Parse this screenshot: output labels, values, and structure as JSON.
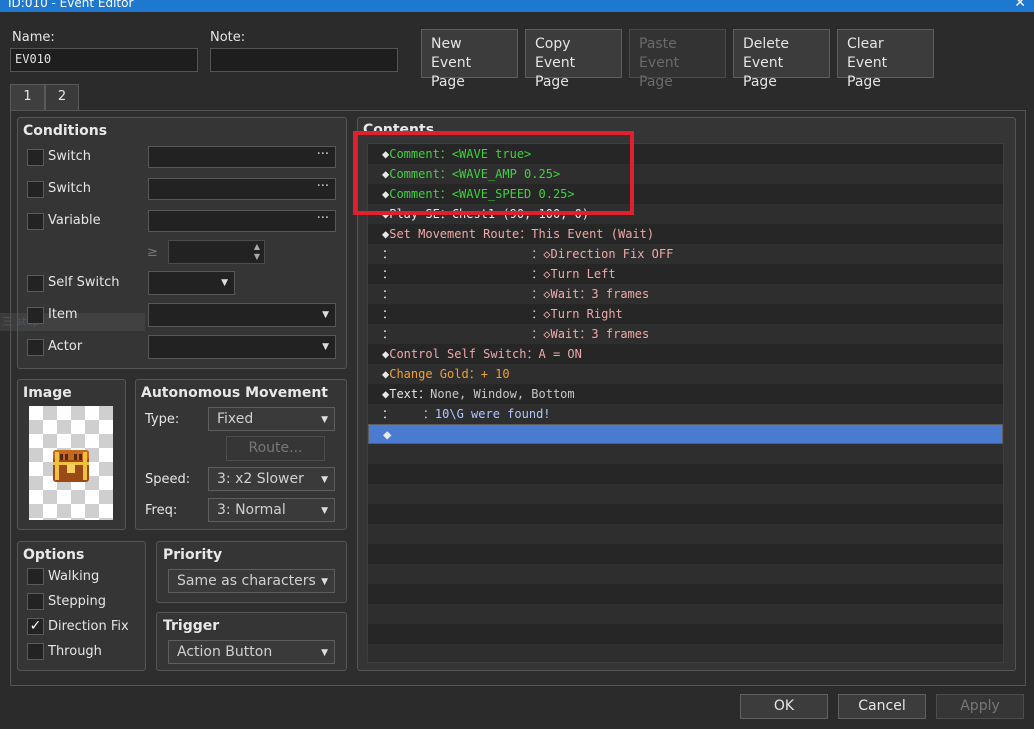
{
  "window": {
    "title": "ID:010 - Event Editor",
    "close_glyph": "✕"
  },
  "name": {
    "label": "Name:",
    "value": "EV010"
  },
  "note": {
    "label": "Note:",
    "value": ""
  },
  "toolbar": {
    "new": [
      "New",
      "Event Page"
    ],
    "copy": [
      "Copy",
      "Event Page"
    ],
    "paste": [
      "Paste",
      "Event Page"
    ],
    "delete": [
      "Delete",
      "Event Page"
    ],
    "clear": [
      "Clear",
      "Event Page"
    ]
  },
  "tabs": [
    "1",
    "2"
  ],
  "conditions": {
    "title": "Conditions",
    "switch1": "Switch",
    "switch2": "Switch",
    "variable": "Variable",
    "gte": "≥",
    "self_switch": "Self Switch",
    "item": "Item",
    "actor": "Actor",
    "dots": "···",
    "ghost_text": "三 stcp"
  },
  "image": {
    "title": "Image",
    "icon": "treasure-chest"
  },
  "autonomous": {
    "title": "Autonomous Movement",
    "type_label": "Type:",
    "type_value": "Fixed",
    "route_label": "Route...",
    "speed_label": "Speed:",
    "speed_value": "3: x2 Slower",
    "freq_label": "Freq:",
    "freq_value": "3: Normal"
  },
  "options": {
    "title": "Options",
    "items": [
      {
        "label": "Walking",
        "checked": ""
      },
      {
        "label": "Stepping",
        "checked": ""
      },
      {
        "label": "Direction Fix",
        "checked": "✓"
      },
      {
        "label": "Through",
        "checked": ""
      }
    ]
  },
  "priority": {
    "title": "Priority",
    "value": "Same as characters"
  },
  "trigger": {
    "title": "Trigger",
    "value": "Action Button"
  },
  "contents": {
    "title": "Contents",
    "rows": [
      {
        "prefix": "◆",
        "cmd": "Comment：",
        "arg": "<WAVE true>"
      },
      {
        "prefix": "◆",
        "cmd": "Comment：",
        "arg": "<WAVE_AMP 0.25>"
      },
      {
        "prefix": "◆",
        "cmd": "Comment：",
        "arg": "<WAVE_SPEED 0.25>"
      },
      {
        "prefix": "◆",
        "cmd": "Play SE：",
        "arg": "Chest1 (90, 100, 0)"
      },
      {
        "prefix": "◆",
        "cmd": "Set Movement Route：",
        "arg": "This Event (Wait)"
      },
      {
        "prefix": "：",
        "cmd": "                   ：",
        "arg": "◇Direction Fix OFF"
      },
      {
        "prefix": "：",
        "cmd": "                   ：",
        "arg": "◇Turn Left"
      },
      {
        "prefix": "：",
        "cmd": "                   ：",
        "arg": "◇Wait：3 frames"
      },
      {
        "prefix": "：",
        "cmd": "                   ：",
        "arg": "◇Turn Right"
      },
      {
        "prefix": "：",
        "cmd": "                   ：",
        "arg": "◇Wait：3 frames"
      },
      {
        "prefix": "◆",
        "cmd": "Control Self Switch：",
        "arg": "A = ON"
      },
      {
        "prefix": "◆",
        "cmd": "Change Gold：",
        "arg": "+ 10"
      },
      {
        "prefix": "◆",
        "cmd": "Text：",
        "arg": "None, Window, Bottom"
      },
      {
        "prefix": "：",
        "cmd": "    ：",
        "arg": "10\\G were found!"
      },
      {
        "prefix": "◆",
        "cmd": "",
        "arg": ""
      }
    ]
  },
  "footer": {
    "ok": "OK",
    "cancel": "Cancel",
    "apply": "Apply"
  },
  "colors": {
    "accent": "#4a7bd0",
    "highlight_box": "#e0202c",
    "comment": "#3fd23f",
    "gold": "#f0a030"
  }
}
